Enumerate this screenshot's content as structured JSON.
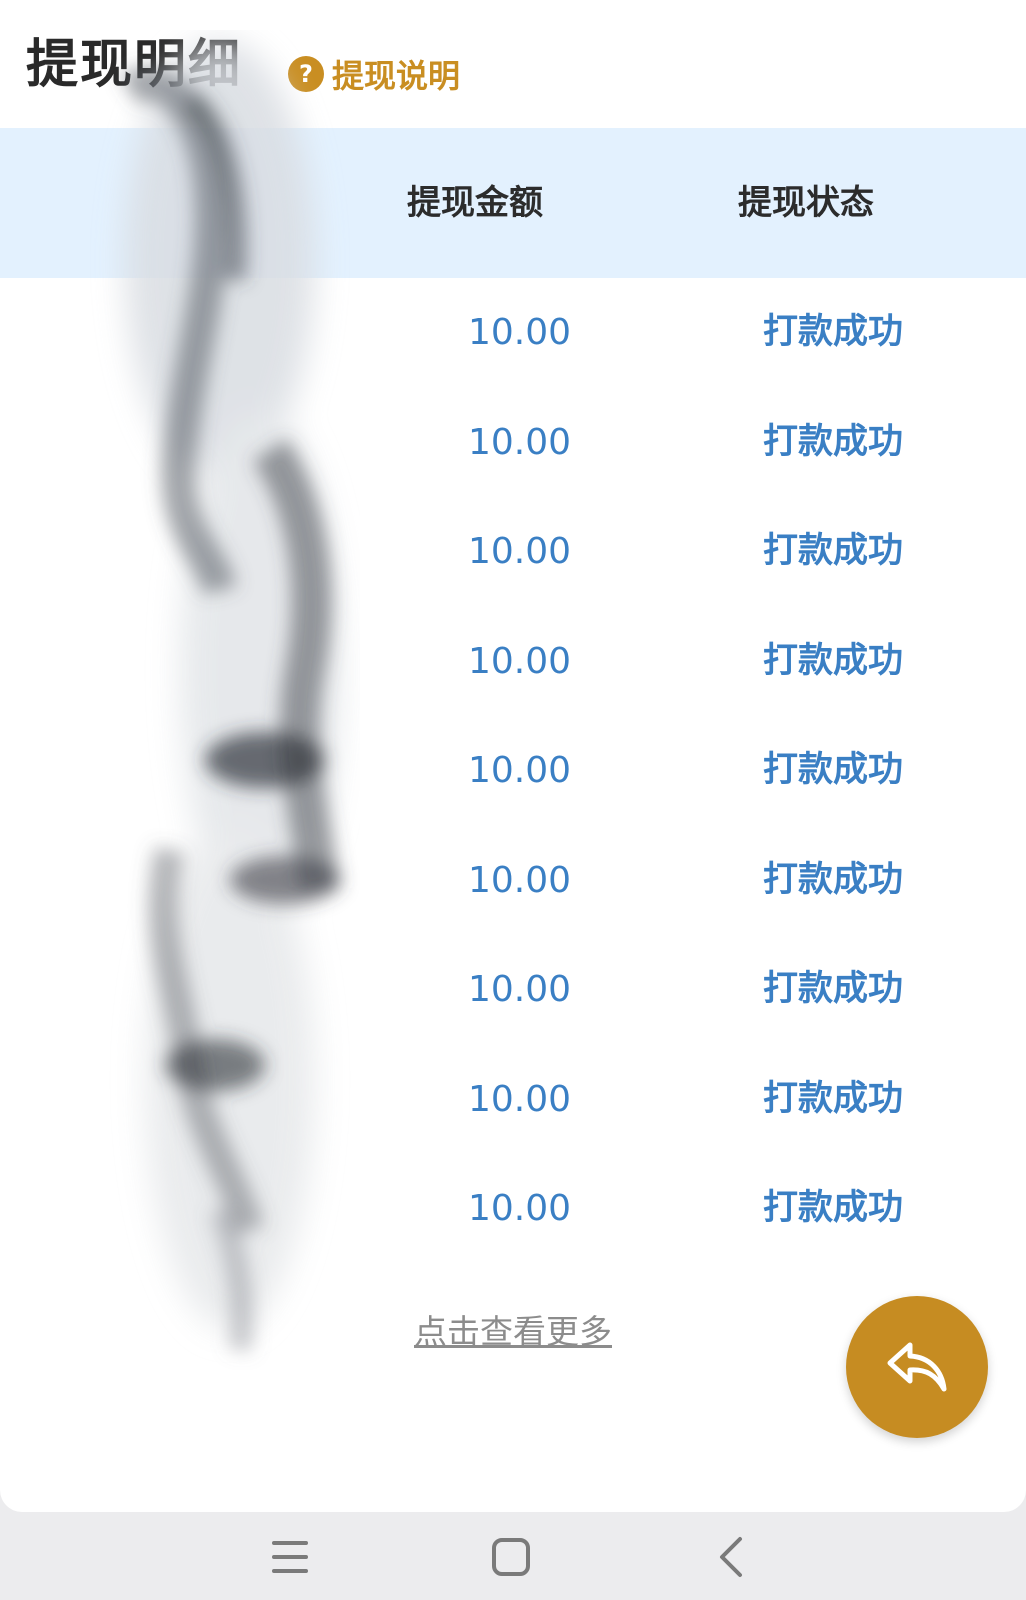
{
  "header": {
    "title": "提现明细",
    "help_label": "提现说明",
    "help_icon_glyph": "?"
  },
  "table": {
    "columns": [
      "提现金额",
      "提现状态"
    ],
    "rows": [
      {
        "amount": "10.00",
        "status": "打款成功"
      },
      {
        "amount": "10.00",
        "status": "打款成功"
      },
      {
        "amount": "10.00",
        "status": "打款成功"
      },
      {
        "amount": "10.00",
        "status": "打款成功"
      },
      {
        "amount": "10.00",
        "status": "打款成功"
      },
      {
        "amount": "10.00",
        "status": "打款成功"
      },
      {
        "amount": "10.00",
        "status": "打款成功"
      },
      {
        "amount": "10.00",
        "status": "打款成功"
      },
      {
        "amount": "10.00",
        "status": "打款成功"
      }
    ]
  },
  "load_more_label": "点击查看更多",
  "fab_icon": "reply-icon",
  "nav": {
    "menu_icon": "menu-icon",
    "home_icon": "home-icon",
    "back_icon": "back-icon"
  },
  "colors": {
    "accent": "#c98e22",
    "header_bg": "#e3f1fe",
    "value_blue": "#3a7fc4",
    "link_gray": "#8c8c8c"
  }
}
